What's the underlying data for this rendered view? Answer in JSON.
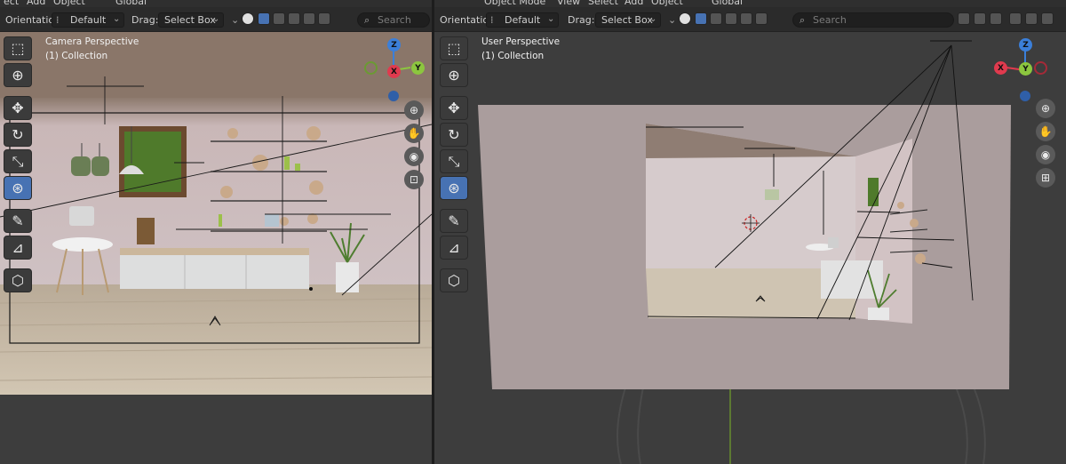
{
  "left": {
    "header": {
      "menu": [
        "ect",
        "Add",
        "Object"
      ],
      "transform": "Global"
    },
    "toolsettings": {
      "orientation_label": "Orientation:",
      "orientation_value": "Default",
      "drag_label": "Drag:",
      "drag_value": "Select Box",
      "search_placeholder": "Search"
    },
    "viewport": {
      "title": "Camera Perspective",
      "subtitle": "(1) Collection"
    }
  },
  "right": {
    "header": {
      "mode": "Object Mode",
      "menu": [
        "View",
        "Select",
        "Add",
        "Object"
      ],
      "transform": "Global"
    },
    "toolsettings": {
      "orientation_label": "Orientation:",
      "orientation_value": "Default",
      "drag_label": "Drag:",
      "drag_value": "Select Box",
      "search_placeholder": "Search"
    },
    "viewport": {
      "title": "User Perspective",
      "subtitle": "(1) Collection"
    }
  },
  "gizmo": {
    "x": "X",
    "y": "Y",
    "z": "Z"
  },
  "toolbar_icons": [
    "select-box-icon",
    "cursor-icon",
    "move-icon",
    "rotate-icon",
    "scale-icon",
    "transform-icon",
    "annotate-icon",
    "measure-icon",
    "add-cube-icon"
  ],
  "colors": {
    "active_tool": "#4772b3",
    "axis_x": "#e03a4e",
    "axis_y": "#8cc63f",
    "axis_z": "#3b7fd9",
    "wall": "#cbbcbf",
    "floor": "#c9bba6"
  }
}
